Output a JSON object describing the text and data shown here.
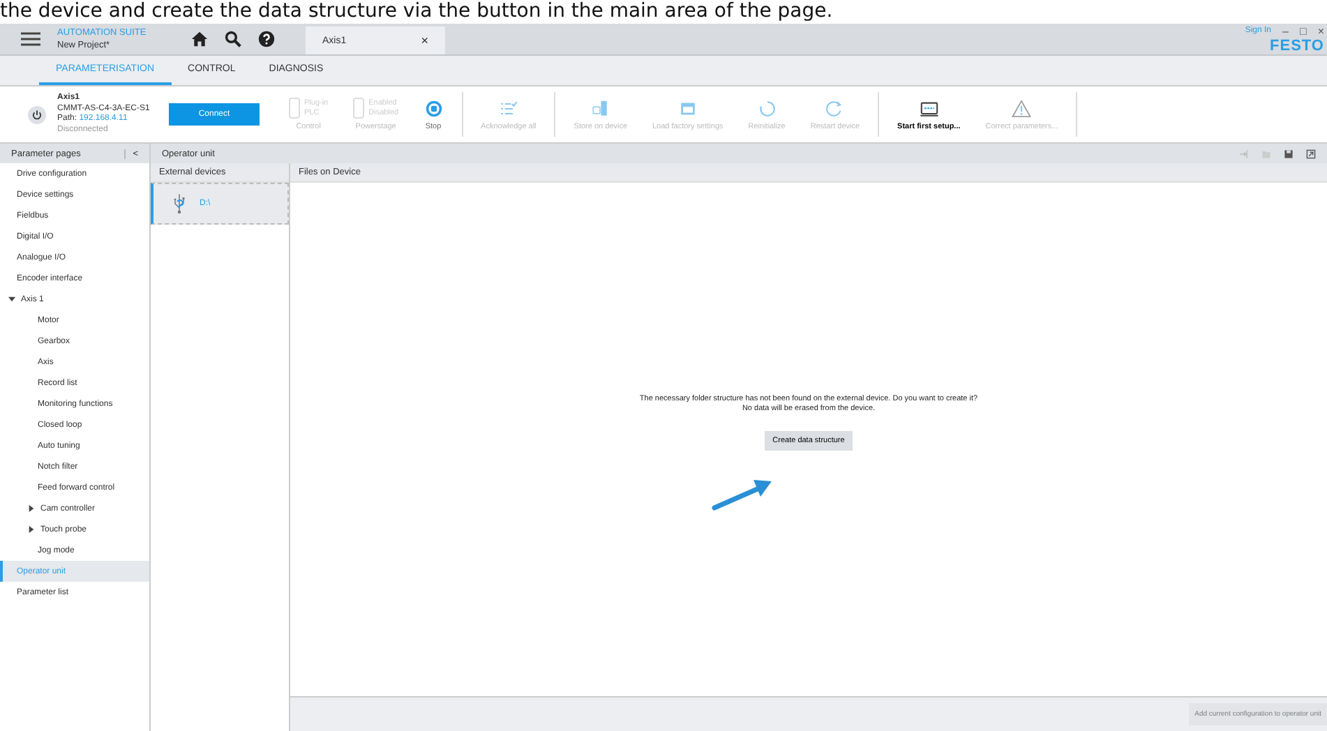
{
  "caption": "the device and create the data structure via the button in the main area of the page.",
  "titlebar": {
    "brand_strong": "AUTOMATION",
    "brand_rest": " SUITE",
    "project": "New Project*",
    "tab": "Axis1",
    "tab_close": "×",
    "sign_in": "Sign In",
    "minimize": "–",
    "maximize": "□",
    "close": "×",
    "logo": "FESTO"
  },
  "nav_tabs": [
    {
      "label": "PARAMETERISATION",
      "selected": true
    },
    {
      "label": "CONTROL",
      "selected": false
    },
    {
      "label": "DIAGNOSIS",
      "selected": false
    }
  ],
  "device": {
    "name": "Axis1",
    "model": "CMMT-AS-C4-3A-EC-S1",
    "path_label": "Path:",
    "path": "192.168.4.11",
    "status": "Disconnected",
    "connect": "Connect"
  },
  "toolbar": [
    {
      "kind": "toggle",
      "top": "Plug-in",
      "bottom": "PLC",
      "label": "Control",
      "disabled": true
    },
    {
      "kind": "toggle",
      "top": "Enabled",
      "bottom": "Disabled",
      "label": "Powerstage",
      "disabled": true
    },
    {
      "kind": "stop",
      "label": "Stop",
      "disabled": false
    },
    {
      "kind": "sep"
    },
    {
      "kind": "ack",
      "label": "Acknowledge all",
      "disabled": true
    },
    {
      "kind": "sep"
    },
    {
      "kind": "store",
      "label": "Store on device",
      "disabled": true
    },
    {
      "kind": "load",
      "label": "Load factory settings",
      "disabled": true
    },
    {
      "kind": "reinit",
      "label": "Reinitialize",
      "disabled": true
    },
    {
      "kind": "restart",
      "label": "Restart device",
      "disabled": true
    },
    {
      "kind": "sep"
    },
    {
      "kind": "setup",
      "label": "Start first setup...",
      "disabled": false
    },
    {
      "kind": "warn",
      "label": "Correct parameters...",
      "disabled": true
    },
    {
      "kind": "sep"
    }
  ],
  "sidebar": {
    "title": "Parameter pages",
    "collapse": "<",
    "items": [
      {
        "label": "Drive configuration",
        "selected": false
      },
      {
        "label": "Device settings",
        "selected": false
      },
      {
        "label": "Fieldbus",
        "selected": false
      },
      {
        "label": "Digital I/O",
        "selected": false
      },
      {
        "label": "Analogue I/O",
        "selected": false
      },
      {
        "label": "Encoder interface",
        "selected": false
      },
      {
        "label": "Axis 1",
        "selected": false,
        "expanded": true,
        "children": [
          {
            "label": "Motor",
            "selected": false
          },
          {
            "label": "Gearbox",
            "selected": false
          },
          {
            "label": "Axis",
            "selected": false
          },
          {
            "label": "Record list",
            "selected": false
          },
          {
            "label": "Monitoring functions",
            "selected": false
          },
          {
            "label": "Closed loop",
            "selected": false
          },
          {
            "label": "Auto tuning",
            "selected": false
          },
          {
            "label": "Notch filter",
            "selected": false
          },
          {
            "label": "Feed forward control",
            "selected": false
          },
          {
            "label": "Cam controller",
            "selected": false,
            "expanded": false
          },
          {
            "label": "Touch probe",
            "selected": false,
            "expanded": false
          },
          {
            "label": "Jog mode",
            "selected": false
          }
        ]
      },
      {
        "label": "Operator unit",
        "selected": true
      },
      {
        "label": "Parameter list",
        "selected": false
      }
    ]
  },
  "page_title": "Operator unit",
  "external_devices": {
    "title": "External devices",
    "items": [
      {
        "label": "D:\\",
        "selected": true
      }
    ]
  },
  "files": {
    "title": "Files on Device",
    "message": "The necessary folder structure has not been found on the external device. Do you want to create it?",
    "message2": "No data will be erased from the device.",
    "button": "Create data structure"
  },
  "footer_button": "Add current configuration to operator unit"
}
